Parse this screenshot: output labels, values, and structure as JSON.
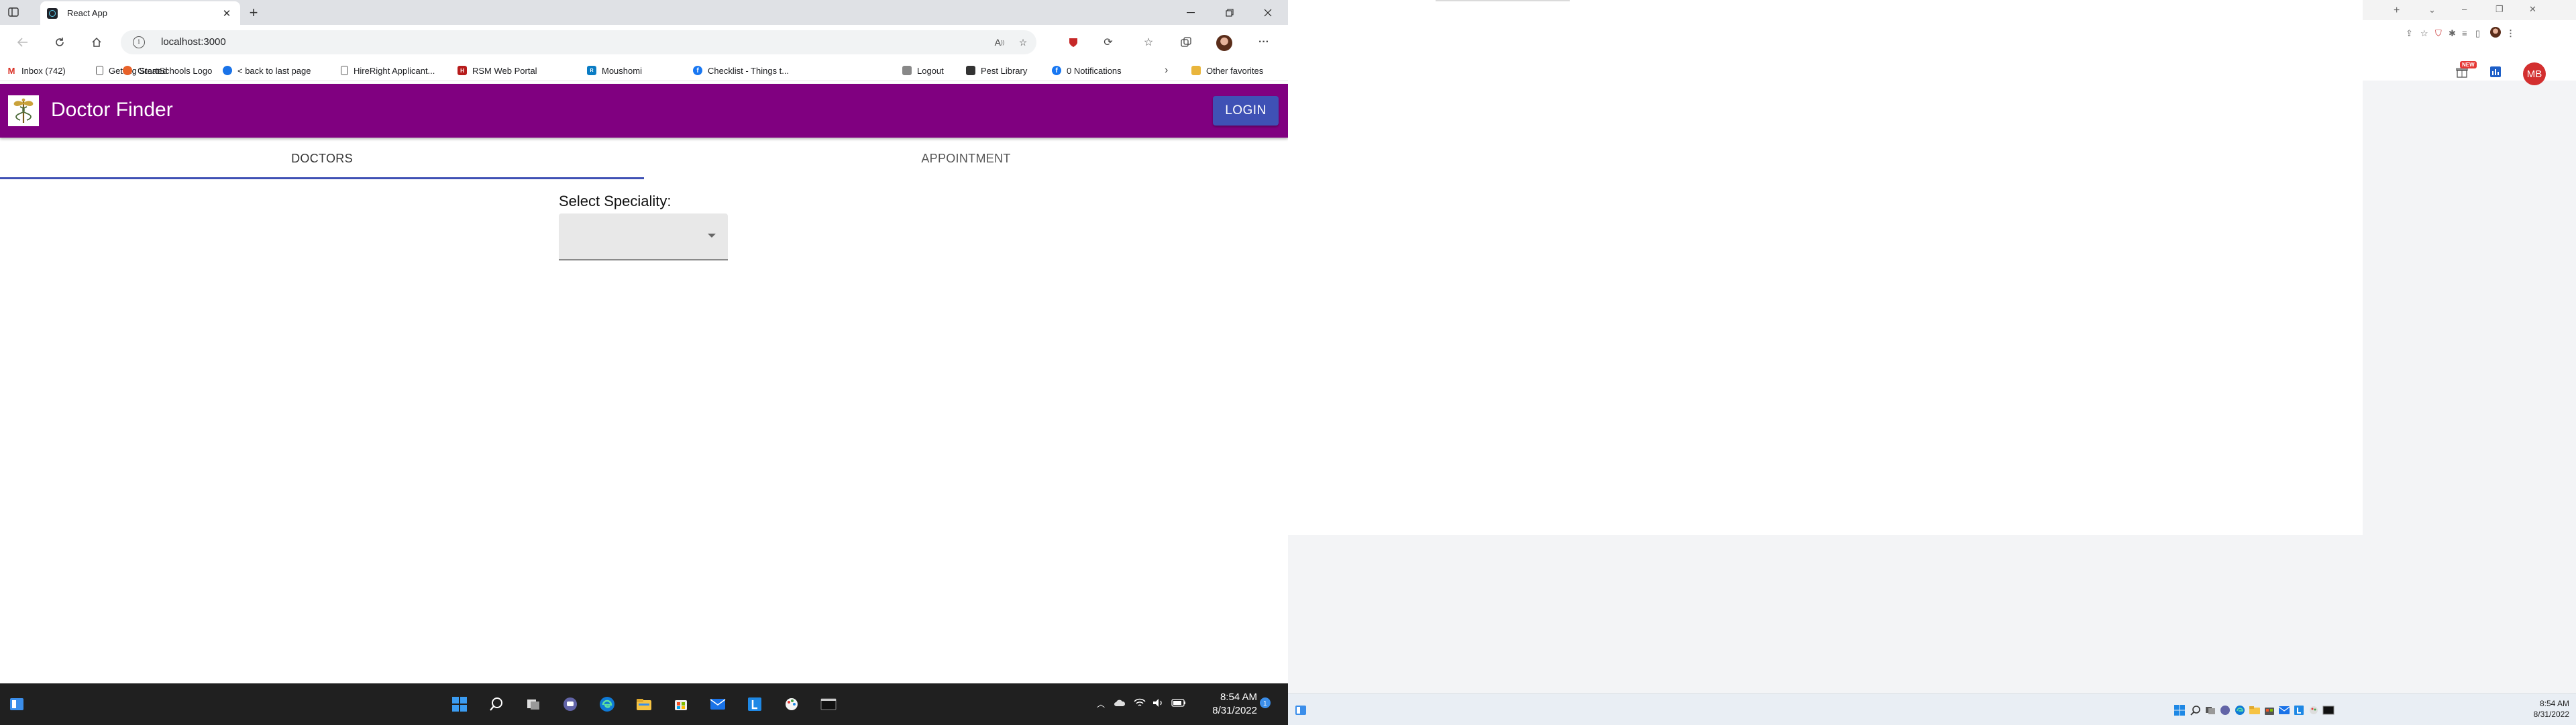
{
  "browser": {
    "tab_title": "React App",
    "url": "localhost:3000",
    "new_tab_symbol": "+",
    "close_symbol": "✕"
  },
  "favorites": [
    {
      "label": "Inbox (742)",
      "icon": "gmail-icon",
      "color": "#d93025"
    },
    {
      "label": "Getting Started",
      "icon": "page-icon",
      "color": "#555555"
    },
    {
      "label": "GreatSchools Logo",
      "icon": "firefox-icon",
      "color": "#e8622a"
    },
    {
      "label": "< back to last page",
      "icon": "globe-icon",
      "color": "#1a73e8"
    },
    {
      "label": "HireRight Applicant...",
      "icon": "page-icon",
      "color": "#555555"
    },
    {
      "label": "RSM Web Portal",
      "icon": "hireright-icon",
      "color": "#b71c1c"
    },
    {
      "label": "Moushomi",
      "icon": "rsm-icon",
      "color": "#0a7cc4"
    },
    {
      "label": "Checklist - Things t...",
      "icon": "facebook-icon",
      "color": "#1877f2"
    },
    {
      "label": "Logout",
      "icon": "checklist-icon",
      "color": "#888888"
    },
    {
      "label": "Pest Library",
      "icon": "logout-icon",
      "color": "#333333"
    },
    {
      "label": "0 Notifications",
      "icon": "pest-icon",
      "color": "#c62828"
    }
  ],
  "favorites_other": "Other favorites",
  "app": {
    "title": "Doctor Finder",
    "login_label": "LOGIN",
    "brand_color": "#800080",
    "accent_color": "#3f51b5",
    "tabs": [
      {
        "label": "DOCTORS",
        "active": true
      },
      {
        "label": "APPOINTMENT",
        "active": false
      }
    ],
    "speciality_label": "Select Speciality:",
    "speciality_value": ""
  },
  "taskbar": {
    "time": "8:54 AM",
    "date": "8/31/2022"
  },
  "right_monitor": {
    "new_badge": "NEW",
    "avatar_initials": "MB",
    "time": "8:54 AM",
    "date": "8/31/2022"
  }
}
